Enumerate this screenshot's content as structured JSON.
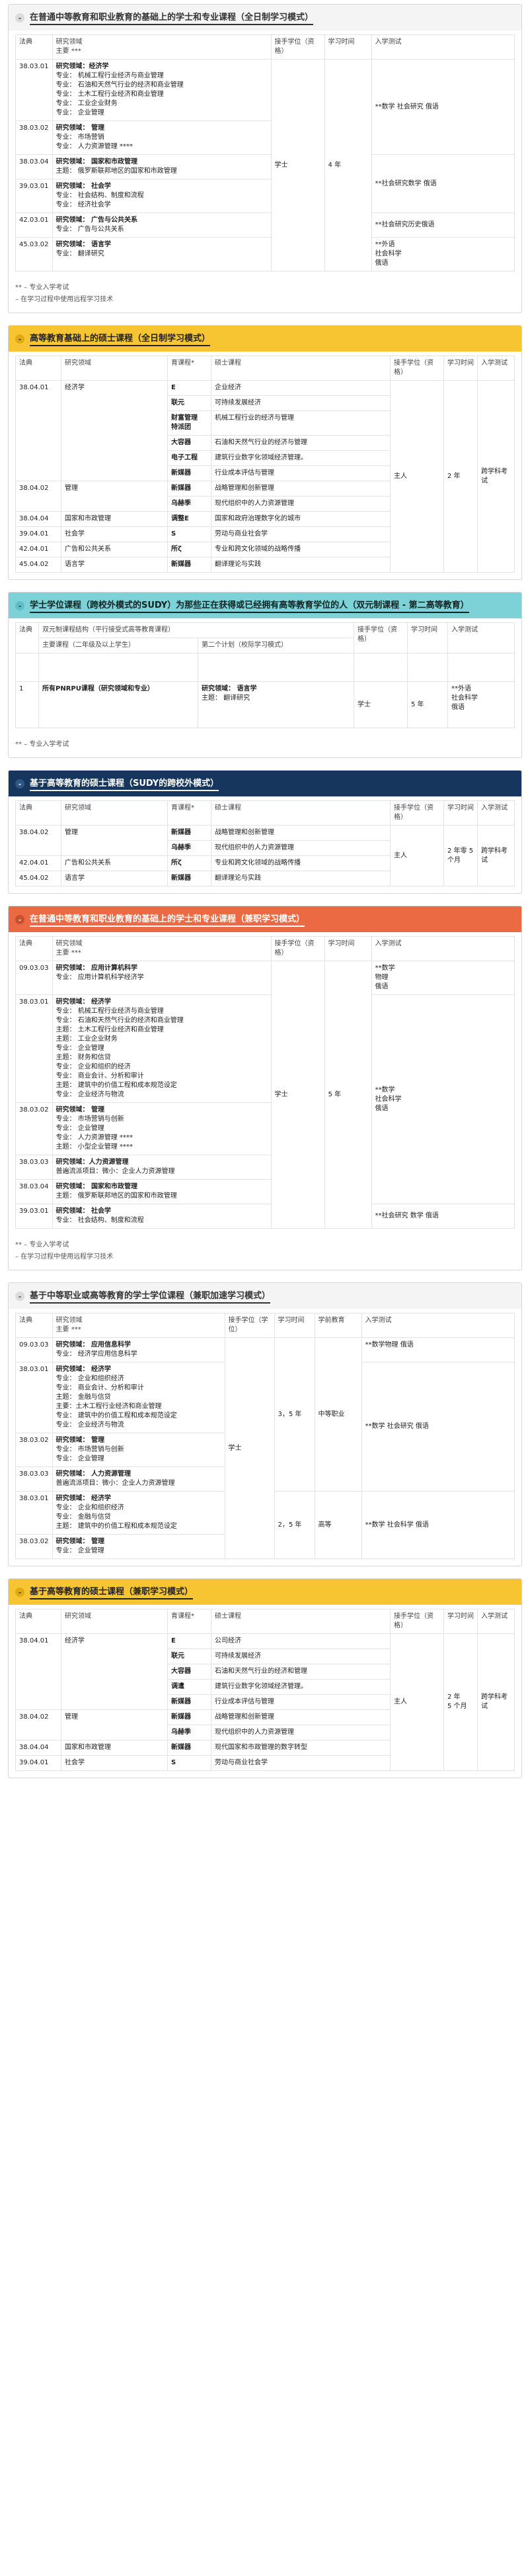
{
  "s1": {
    "title": "在普通中等教育和职业教育的基础上的学士和专业课程（全日制学习模式）",
    "headers": {
      "code": "法典",
      "field": "研究领域\n主要 ***",
      "degree": "接手学位（资格）",
      "years": "学习时间",
      "exam": "入学测试"
    },
    "rows": [
      {
        "code": "38.03.01",
        "lines": [
          "研究领域：经济学",
          "专业：  机械工程行业经济与商业管理",
          "专业：  石油和天然气行业的经济和商业管理",
          "专业：  土木工程行业经济和商业管理",
          "专业：  工业企业财务",
          "专业：  企业管理"
        ]
      },
      {
        "code": "38.03.02",
        "lines": [
          "研究领域： 管理",
          "专业：  市场营销",
          "专业：  人力资源管理 ****"
        ]
      },
      {
        "code": "38.03.04",
        "lines": [
          "研究领域： 国家和市政管理",
          "主题：  俄罗斯联邦地区的国家和市政管理"
        ]
      },
      {
        "code": "39.03.01",
        "lines": [
          "研究领域： 社会学",
          "专业：  社会结构、制度和流程",
          "专业：  经济社会学"
        ]
      },
      {
        "code": "42.03.01",
        "lines": [
          "研究领域： 广告与公共关系",
          "专业：  广告与公共关系"
        ]
      },
      {
        "code": "45.03.02",
        "lines": [
          "研究领域： 语言学",
          "专业：  翻译研究"
        ]
      }
    ],
    "degree": "学士",
    "years": "4 年",
    "exams": [
      "**数学 社会研究 俄语",
      "**社会研究数学 俄语",
      "**社会研究历史俄语",
      "**外语\n社会科学\n俄语"
    ],
    "notes": [
      "** – 专业入学考试",
      "– 在学习过程中使用远程学习技术"
    ]
  },
  "s2": {
    "title": "高等教育基础上的硕士课程（全日制学习模式）",
    "headers": {
      "code": "法典",
      "field": "研究领域",
      "prog": "育课程*",
      "master": "硕士课程",
      "degree": "接手学位（资格）",
      "years": "学习时间",
      "exam": "入学测试"
    },
    "rows": [
      {
        "code": "38.04.01",
        "field": "经济学",
        "items": [
          [
            "E",
            "企业经济"
          ],
          [
            "联元",
            "可持续发展经济"
          ],
          [
            "财富管理\n特派团",
            "机械工程行业的经济与管理"
          ],
          [
            "大容器",
            "石油和天然气行业的经济与管理"
          ],
          [
            "电子工程",
            "建筑行业数字化领域经济管理。"
          ],
          [
            "新媒器",
            "行业成本评估与管理"
          ]
        ]
      },
      {
        "code": "38.04.02",
        "field": "管理",
        "items": [
          [
            "新媒器",
            "战略管理和创新管理"
          ],
          [
            "乌赫季",
            "现代组织中的人力资源管理"
          ]
        ]
      },
      {
        "code": "38.04.04",
        "field": "国家和市政管理",
        "items": [
          [
            "调整E",
            "国家和政府治理数字化的城市"
          ]
        ]
      },
      {
        "code": "39.04.01",
        "field": "社会学",
        "items": [
          [
            "S",
            "劳动与商业社会学"
          ]
        ]
      },
      {
        "code": "42.04.01",
        "field": "广告和公共关系",
        "items": [
          [
            "所ζ",
            "专业和跨文化领域的战略传播"
          ]
        ]
      },
      {
        "code": "45.04.02",
        "field": "语言学",
        "items": [
          [
            "新媒器",
            "翻译理论与实践"
          ]
        ]
      }
    ],
    "degree": "主人",
    "years": "2 年",
    "exam": "跨学科考试"
  },
  "s3": {
    "title": "学士学位课程（跨校外模式的SUDY）为那些正在获得或已经拥有高等教育学位的人（双元制课程 - 第二高等教育）",
    "headers": {
      "code": "法典",
      "dual": "双元制课程结构（平行接受式高等教育课程）",
      "main": "主要课程（二年级及以上学生）",
      "second": "第二个计划（校际学习模式）",
      "degree": "接手学位（资格）",
      "years": "学习时间",
      "exam": "入学测试"
    },
    "row": {
      "code": "1",
      "main": "所有PNRPU课程（研究领域和专业）",
      "second": [
        "研究领域： 语言学",
        "主题：  翻译研究"
      ],
      "degree": "学士",
      "years": "5 年",
      "exam": "**外语\n社会科学\n俄语"
    },
    "notes": [
      "** – 专业入学考试"
    ]
  },
  "s4": {
    "title": "基于高等教育的硕士课程（SUDY的跨校外模式）",
    "headers": {
      "code": "法典",
      "field": "研究领域",
      "prog": "育课程*",
      "master": "硕士课程",
      "degree": "接手学位（资格）",
      "years": "学习时间",
      "exam": "入学测试"
    },
    "rows": [
      {
        "code": "38.04.02",
        "field": "管理",
        "items": [
          [
            "新媒器",
            "战略管理和创新管理"
          ],
          [
            "乌赫季",
            "现代组织中的人力资源管理"
          ]
        ]
      },
      {
        "code": "42.04.01",
        "field": "广告和公共关系",
        "items": [
          [
            "所ζ",
            "专业和跨文化领域的战略传播"
          ]
        ]
      },
      {
        "code": "45.04.02",
        "field": "语言学",
        "items": [
          [
            "新媒器",
            "翻译理论与实践"
          ]
        ]
      }
    ],
    "degree": "主人",
    "years": "2 年零 5 个月",
    "exam": "跨学科考试"
  },
  "s5": {
    "title": "在普通中等教育和职业教育的基础上的学士和专业课程（兼职学习模式）",
    "headers": {
      "code": "法典",
      "field": "研究领域\n主要 ***",
      "degree": "接手学位（资格）",
      "years": "学习时间",
      "exam": "入学测试"
    },
    "rows": [
      {
        "code": "09.03.03",
        "lines": [
          "研究领域： 应用计算机科学",
          "专业：  应用计算机科学经济学"
        ]
      },
      {
        "code": "38.03.01",
        "lines": [
          "研究领域： 经济学",
          "专业：  机械工程行业经济与商业管理",
          "专业：  石油和天然气行业的经济和商业管理",
          "主题：  土木工程行业经济和商业管理",
          "主题：  工业企业财务",
          "专业：  企业管理",
          "主题：  财务和信贷",
          "专业：  企业和组织的经济",
          "专业：  商业会计、分析和审计",
          "主题：  建筑中的价值工程和成本规范设定",
          "专业：  企业经济与物流"
        ]
      },
      {
        "code": "38.03.02",
        "lines": [
          "研究领域： 管理",
          "专业：  市场营销与创新",
          "专业：  企业管理",
          "专业：  人力资源管理 ****",
          "主题：  小型企业管理 ****"
        ]
      },
      {
        "code": "38.03.03",
        "lines": [
          "研究领域：人力资源管理",
          "普遍流派项目：微小：企业人力资源管理"
        ]
      },
      {
        "code": "38.03.04",
        "lines": [
          "研究领域： 国家和市政管理",
          "主题：  俄罗斯联邦地区的国家和市政管理"
        ]
      },
      {
        "code": "39.03.01",
        "lines": [
          "研究领域： 社会学",
          "专业：  社会结构、制度和流程"
        ]
      }
    ],
    "degree": "学士",
    "years": "5 年",
    "exams": [
      "**数学\n物理\n俄语",
      "**数学\n社会科学\n俄语",
      "**社会研究 数学 俄语"
    ],
    "notes": [
      "** – 专业入学考试",
      "– 在学习过程中使用远程学习技术"
    ]
  },
  "s6": {
    "title": "基于中等职业或高等教育的学士学位课程（兼职加速学习模式）",
    "headers": {
      "code": "法典",
      "field": "研究领域\n主要 ***",
      "degree": "接手学位（学位）",
      "years": "学习时间",
      "base": "学前教育",
      "exam": "入学测试"
    },
    "rows": [
      {
        "code": "09.03.03",
        "lines": [
          "研究领域： 应用信息科学",
          "专业：  经济学应用信息科学"
        ]
      },
      {
        "code": "38.03.01",
        "lines": [
          "研究领域： 经济学",
          "专业：  企业和组织经济",
          "专业：  商业会计、分析和审计",
          "主题：  金融与信贷",
          "主要：土木工程行业经济和商业管理",
          "专业：  建筑中的价值工程和成本规范设定",
          "专业：  企业经济与物流"
        ]
      },
      {
        "code": "38.03.02",
        "lines": [
          "研究领域： 管理",
          "专业：  市场营销与创新",
          "专业：  企业管理"
        ]
      },
      {
        "code": "38.03.03",
        "lines": [
          "研究领域： 人力资源管理",
          "普遍流派项目：微小：企业人力资源管理"
        ]
      },
      {
        "code": "38.03.01",
        "lines": [
          "研究领域： 经济学",
          "专业：  企业和组织经济",
          "专业：  金融与信贷",
          "主题：  建筑中的价值工程和成本规范设定"
        ]
      },
      {
        "code": "38.03.02",
        "lines": [
          "研究领域： 管理",
          "专业：  企业管理"
        ]
      }
    ],
    "degree": "学士",
    "years1": "3，5 年",
    "base1": "中等职业",
    "years2": "2，5 年",
    "base2": "高等",
    "exams": [
      "**数学物理 俄语",
      "**数学 社会研究 俄语",
      "**数学 社会科学 俄语"
    ]
  },
  "s7": {
    "title": "基于高等教育的硕士课程（兼职学习模式）",
    "headers": {
      "code": "法典",
      "field": "研究领域",
      "prog": "育课程*",
      "master": "硕士课程",
      "degree": "接手学位（资格）",
      "years": "学习时间",
      "exam": "入学测试"
    },
    "rows": [
      {
        "code": "38.04.01",
        "field": "经济学",
        "items": [
          [
            "E",
            "公司经济"
          ],
          [
            "联元",
            "可持续发展经济"
          ],
          [
            "大容器",
            "石油和天然气行业的经济和管理"
          ],
          [
            "调遣",
            "建筑行业数字化领域经济管理。"
          ],
          [
            "新媒器",
            "行业成本评估与管理"
          ]
        ]
      },
      {
        "code": "38.04.02",
        "field": "管理",
        "items": [
          [
            "新媒器",
            "战略管理和创新管理"
          ],
          [
            "乌赫季",
            "现代组织中的人力资源管理"
          ]
        ]
      },
      {
        "code": "38.04.04",
        "field": "国家和市政管理",
        "items": [
          [
            "新媒器",
            "现代国家和市政管理的数字转型"
          ]
        ]
      },
      {
        "code": "39.04.01",
        "field": "社会学",
        "items": [
          [
            "S",
            "劳动与商业社会学"
          ]
        ]
      }
    ],
    "degree": "主人",
    "years": "2 年\n5 个月",
    "exam": "跨学科考试"
  }
}
